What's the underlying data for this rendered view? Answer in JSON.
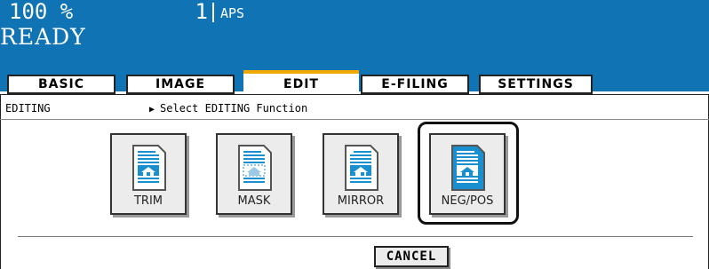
{
  "status": {
    "zoom": "100  %",
    "copies": "1",
    "paper": "APS",
    "message": "READY"
  },
  "tabs": [
    {
      "label": "BASIC"
    },
    {
      "label": "IMAGE"
    },
    {
      "label": "EDIT",
      "active": true
    },
    {
      "label": "E-FILING"
    },
    {
      "label": "SETTINGS"
    }
  ],
  "panel": {
    "mode_label": "EDITING",
    "instruction": "Select EDITING Function"
  },
  "functions": [
    {
      "label": "TRIM",
      "icon": "trim-icon"
    },
    {
      "label": "MASK",
      "icon": "mask-icon"
    },
    {
      "label": "MIRROR",
      "icon": "mirror-icon"
    },
    {
      "label": "NEG/POS",
      "icon": "neg-pos-icon",
      "selected": true
    }
  ],
  "cancel_label": "CANCEL",
  "colors": {
    "status_bg": "#0f73b4",
    "active_tab_accent": "#f0a800",
    "icon_blue": "#1a8fd0"
  }
}
